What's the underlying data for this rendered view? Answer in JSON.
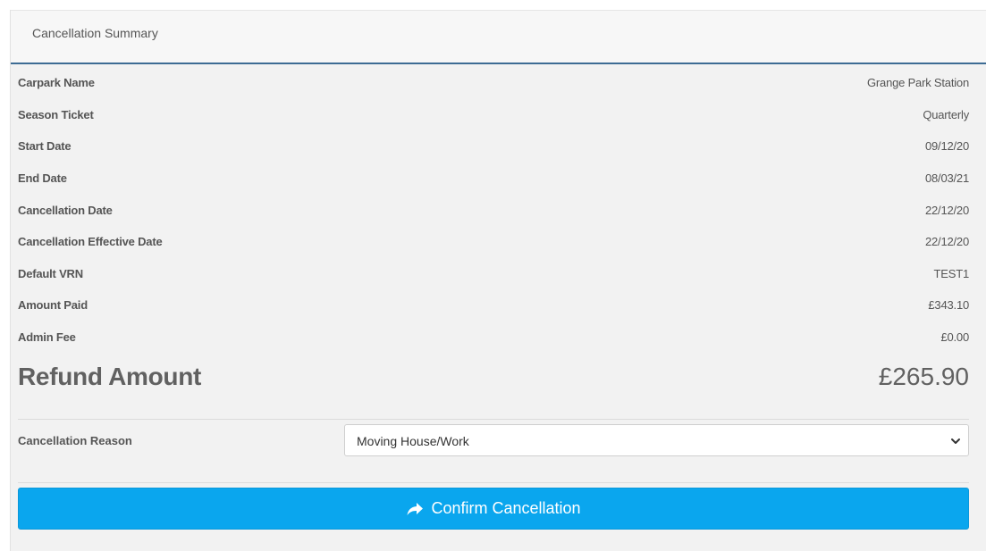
{
  "panel": {
    "title": "Cancellation Summary"
  },
  "summary": {
    "rows": [
      {
        "label": "Carpark Name",
        "value": "Grange Park Station"
      },
      {
        "label": "Season Ticket",
        "value": "Quarterly"
      },
      {
        "label": "Start Date",
        "value": "09/12/20"
      },
      {
        "label": "End Date",
        "value": "08/03/21"
      },
      {
        "label": "Cancellation Date",
        "value": "22/12/20"
      },
      {
        "label": "Cancellation Effective Date",
        "value": "22/12/20"
      },
      {
        "label": "Default VRN",
        "value": "TEST1"
      },
      {
        "label": "Amount Paid",
        "value": "£343.10"
      },
      {
        "label": "Admin Fee",
        "value": "£0.00"
      }
    ],
    "refund_label": "Refund Amount",
    "refund_value": "£265.90"
  },
  "reason": {
    "label": "Cancellation Reason",
    "selected": "Moving House/Work"
  },
  "confirm": {
    "label": "Confirm Cancellation",
    "icon": "share-forward-icon"
  },
  "colors": {
    "header_border": "#3d6c94",
    "button": "#0aa6ee",
    "panel_bg": "#f2f2f2"
  }
}
